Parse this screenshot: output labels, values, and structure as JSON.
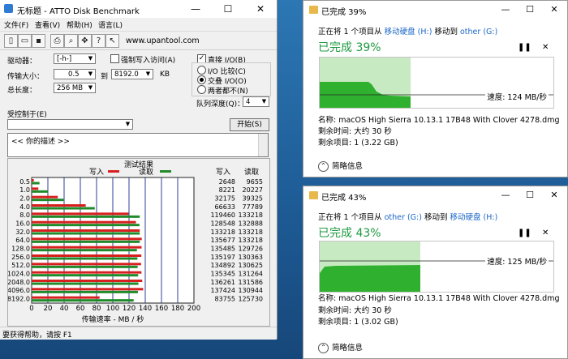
{
  "atto": {
    "title": "无标题 - ATTO Disk Benchmark",
    "window_buttons": [
      "—",
      "☐",
      "✕"
    ],
    "menu": [
      "文件(F)",
      "查看(V)",
      "帮助(H)",
      "语言(L)"
    ],
    "toolbar_icons": [
      "new-file-icon",
      "open-folder-icon",
      "save-icon",
      "print-icon",
      "zoom-icon",
      "move-icon",
      "help-icon",
      "context-help-icon"
    ],
    "website": "www.upantool.com",
    "drive_label": "驱动器：",
    "drive_value": "[-h-]",
    "force_write_label": "强制写入访问(A)",
    "direct_io_label": "直接 I/O(B)",
    "direct_io_checked": "✓",
    "transfer_label": "传输大小：",
    "transfer_from": "0.5",
    "transfer_to_label": "到",
    "transfer_to": "8192.0",
    "transfer_unit": "KB",
    "total_label": "总长度：",
    "total_value": "256 MB",
    "io_options": [
      "I/O 比较(C)",
      "交叠 I/O(O)",
      "两者都不(N)"
    ],
    "io_selected": 1,
    "queue_label": "队列深度(Q)：",
    "queue_value": "4",
    "control_label": "受控制于(E)",
    "control_value": "",
    "start_button": "开始(S)",
    "description": "<<  你的描述  >>",
    "status": "要获得帮助，请按 F1"
  },
  "chart_data": {
    "type": "bar",
    "title": "测试结果",
    "legend": [
      {
        "name": "写入",
        "color": "#d81f1f"
      },
      {
        "name": "读取",
        "color": "#1f8a2a"
      }
    ],
    "col_headers": [
      "写入",
      "读取"
    ],
    "categories": [
      "0.5",
      "1.0",
      "2.0",
      "4.0",
      "8.0",
      "16.0",
      "32.0",
      "64.0",
      "128.0",
      "256.0",
      "512.0",
      "1024.0",
      "2048.0",
      "4096.0",
      "8192.0"
    ],
    "series": [
      {
        "name": "写入",
        "values": [
          2648,
          8221,
          32175,
          66633,
          119460,
          128548,
          133218,
          135677,
          135485,
          135197,
          134892,
          135345,
          136261,
          137424,
          83755
        ]
      },
      {
        "name": "读取",
        "values": [
          9655,
          20227,
          39325,
          77789,
          133218,
          132888,
          133218,
          133218,
          129726,
          130363,
          130625,
          131264,
          131586,
          130944,
          125730
        ]
      }
    ],
    "x_ticks": [
      "0",
      "20",
      "40",
      "60",
      "80",
      "100",
      "120",
      "140",
      "160",
      "180",
      "200"
    ],
    "xlim": [
      0,
      200
    ],
    "xlabel": "传输速率 - MB / 秒",
    "grid": true
  },
  "copy1": {
    "title": "已完成 39%",
    "line_prefix": "正在将 1 个项目从",
    "source": "移动硬盘 (H:)",
    "mid": "移动到",
    "dest": "other (G:)",
    "percent": "已完成 39%",
    "progress": 0.39,
    "speed": "速度: 124 MB/秒",
    "name": "名称: macOS High Sierra 10.13.1 17B48 With Clover 4278.dmg",
    "remaining_time": "剩余时间: 大约 30 秒",
    "remaining_items": "剩余项目: 1 (3.22 GB)",
    "more": "简略信息"
  },
  "copy2": {
    "title": "已完成 43%",
    "line_prefix": "正在将 1 个项目从",
    "source": "other (G:)",
    "mid": "移动到",
    "dest": "移动硬盘 (H:)",
    "percent": "已完成 43%",
    "progress": 0.43,
    "speed": "速度: 125 MB/秒",
    "name": "名称: macOS High Sierra 10.13.1 17B48 With Clover 4278.dmg",
    "remaining_time": "剩余时间: 大约 30 秒",
    "remaining_items": "剩余项目: 1 (3.02 GB)",
    "more": "简略信息"
  },
  "dialog_buttons": [
    "—",
    "☐",
    "✕"
  ],
  "pause_icon": "pause-icon",
  "close_icon": "close-icon"
}
